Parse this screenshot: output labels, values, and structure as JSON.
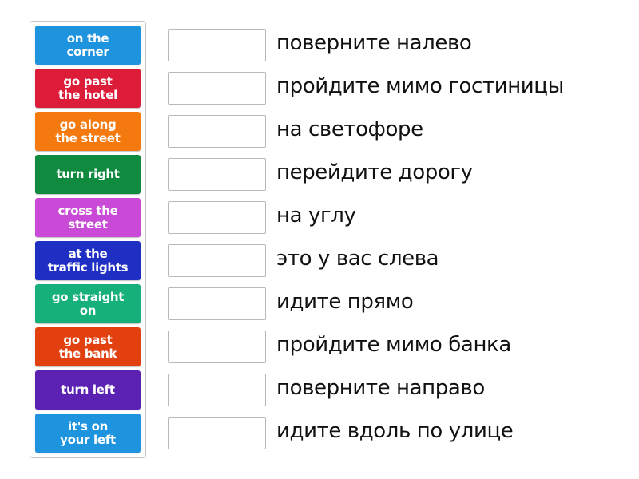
{
  "tiles": [
    {
      "label": "on the\ncorner",
      "color": "#1e93de"
    },
    {
      "label": "go past\nthe hotel",
      "color": "#dc1c38"
    },
    {
      "label": "go along\nthe street",
      "color": "#f47a0f"
    },
    {
      "label": "turn right",
      "color": "#0f8a3f"
    },
    {
      "label": "cross the\nstreet",
      "color": "#c94ad6"
    },
    {
      "label": "at the\ntraffic lights",
      "color": "#1f2fc4"
    },
    {
      "label": "go straight\non",
      "color": "#16b07a"
    },
    {
      "label": "go past\nthe bank",
      "color": "#e2400f"
    },
    {
      "label": "turn left",
      "color": "#5a21b3"
    },
    {
      "label": "it's on\nyour left",
      "color": "#1e93de"
    }
  ],
  "prompts": [
    "поверните налево",
    "пройдите мимо гостиницы",
    "на светофоре",
    "перейдите дорогу",
    "на углу",
    "это у вас слева",
    "идите прямо",
    "пройдите мимо банка",
    "поверните направо",
    "идите вдоль по улице"
  ]
}
